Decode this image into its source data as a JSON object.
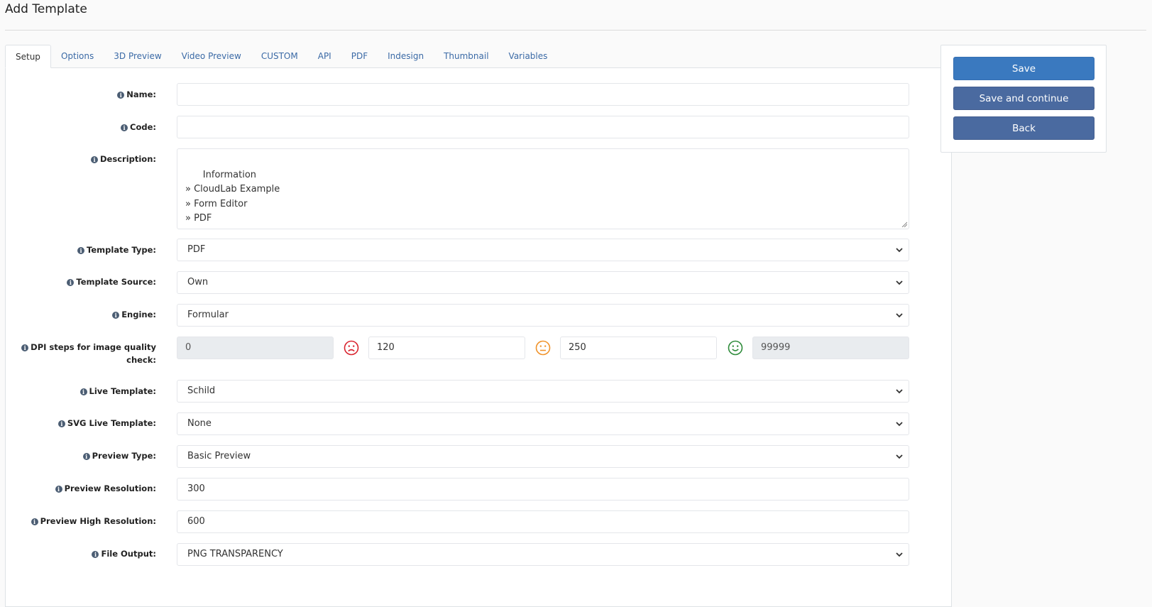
{
  "page": {
    "title": "Add Template"
  },
  "tabs": [
    "Setup",
    "Options",
    "3D Preview",
    "Video Preview",
    "CUSTOM",
    "API",
    "PDF",
    "Indesign",
    "Thumbnail",
    "Variables"
  ],
  "form": {
    "name": {
      "label": "Name:",
      "value": ""
    },
    "code": {
      "label": "Code:",
      "value": ""
    },
    "description": {
      "label": "Description:",
      "value": "Information\n» CloudLab Example\n» Form Editor\n» PDF"
    },
    "template_type": {
      "label": "Template Type:",
      "value": "PDF"
    },
    "template_source": {
      "label": "Template Source:",
      "value": "Own"
    },
    "engine": {
      "label": "Engine:",
      "value": "Formular"
    },
    "dpi": {
      "label_line1": "DPI steps for image quality",
      "label_line2": "check:",
      "v0": "0",
      "v1": "120",
      "v2": "250",
      "v3": "99999"
    },
    "live_template": {
      "label": "Live Template:",
      "value": "Schild"
    },
    "svg_live_template": {
      "label": "SVG Live Template:",
      "value": "None"
    },
    "preview_type": {
      "label": "Preview Type:",
      "value": "Basic Preview"
    },
    "preview_resolution": {
      "label": "Preview Resolution:",
      "value": "300"
    },
    "preview_high_resolution": {
      "label": "Preview High Resolution:",
      "value": "600"
    },
    "file_output": {
      "label": "File Output:",
      "value": "PNG TRANSPARENCY"
    }
  },
  "actions": {
    "save": "Save",
    "save_continue": "Save and continue",
    "back": "Back"
  },
  "colors": {
    "accent": "#3a79bf",
    "secondary": "#4a6aa0",
    "sad": "#d9232e",
    "neutral": "#f0932b",
    "happy": "#2e8b3a"
  },
  "icons": {
    "info": "info-icon",
    "select": "chevron-down-icon",
    "sad": "sad-face-icon",
    "neutral": "neutral-face-icon",
    "happy": "happy-face-icon"
  }
}
